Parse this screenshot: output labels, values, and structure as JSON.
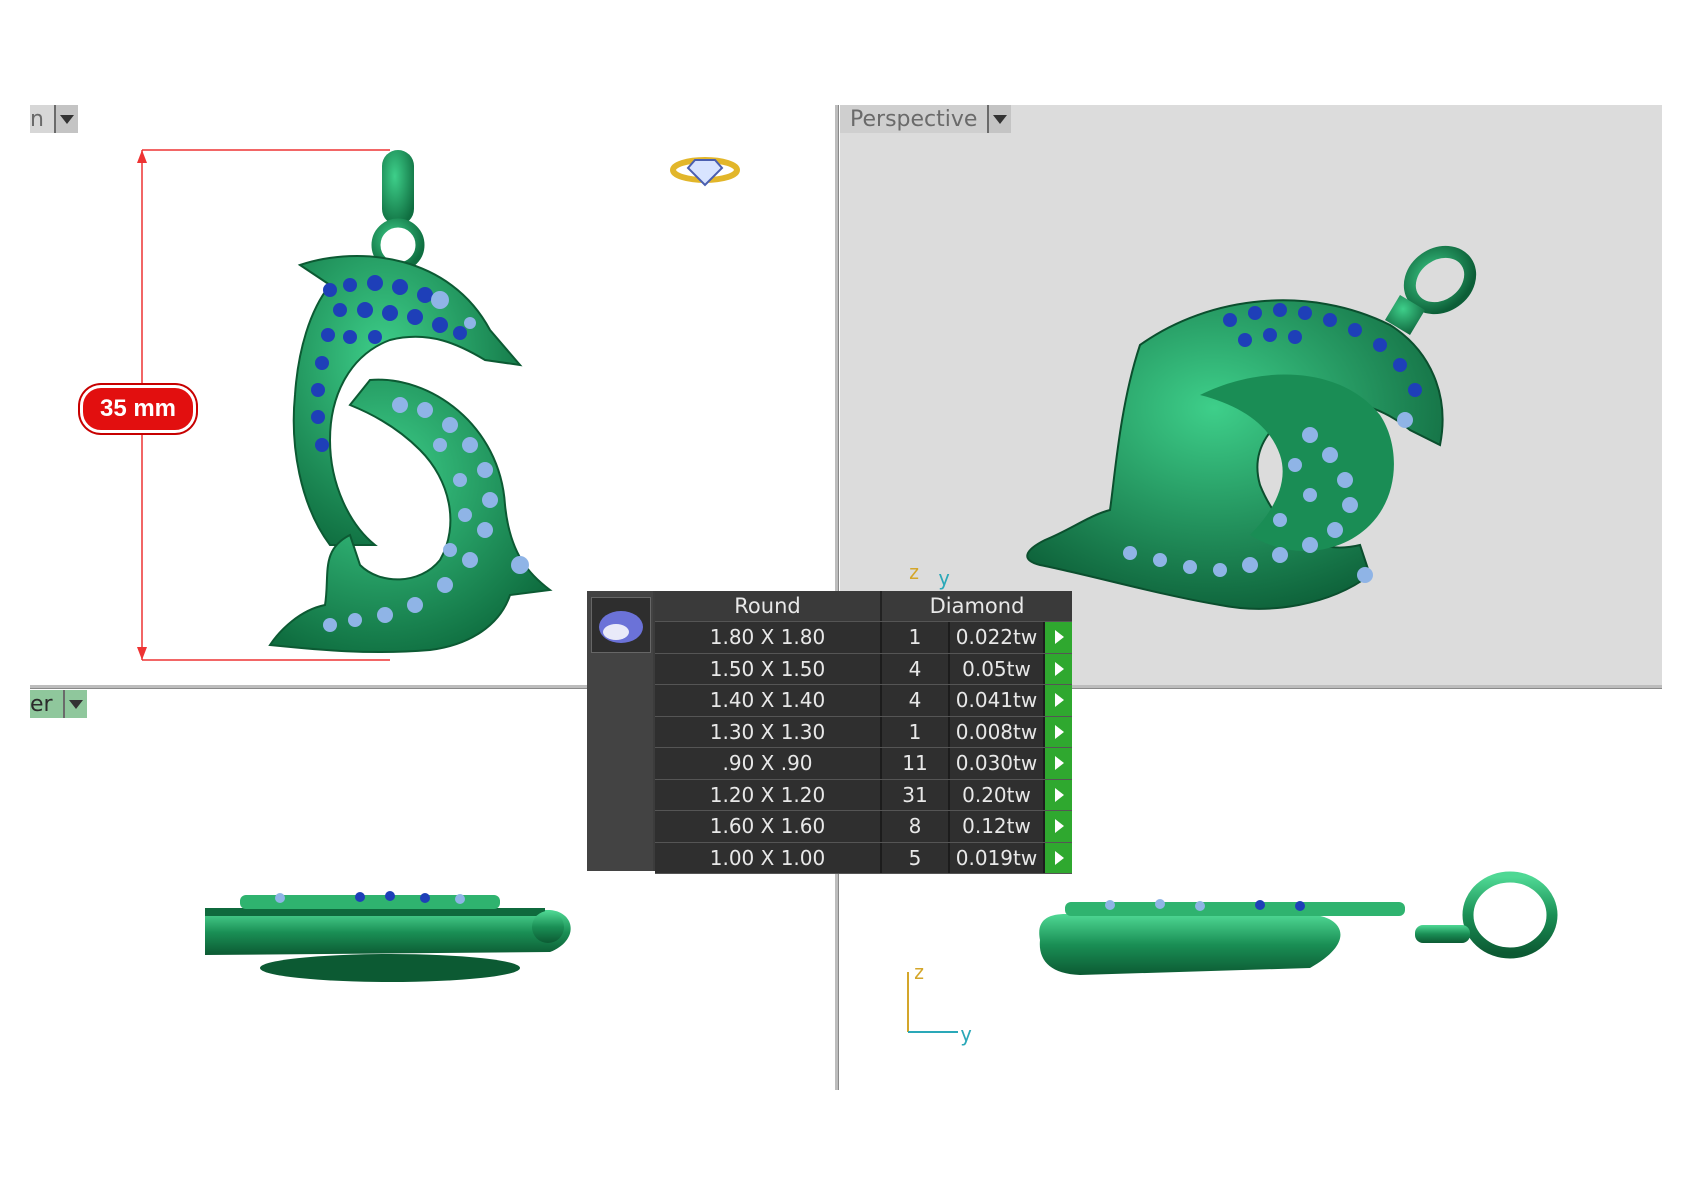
{
  "viewports": {
    "top_left": {
      "tab_label": "n"
    },
    "top_right": {
      "tab_label": "Perspective"
    },
    "bottom_left": {
      "tab_label": "er"
    }
  },
  "dimension": {
    "label": "35 mm"
  },
  "axes": {
    "z": "z",
    "y": "y"
  },
  "stone_table": {
    "shape": "Round",
    "material": "Diamond",
    "rows": [
      {
        "size": "1.80 X 1.80",
        "qty": "1",
        "weight": "0.022tw"
      },
      {
        "size": "1.50 X 1.50",
        "qty": "4",
        "weight": "0.05tw"
      },
      {
        "size": "1.40 X 1.40",
        "qty": "4",
        "weight": "0.041tw"
      },
      {
        "size": "1.30 X 1.30",
        "qty": "1",
        "weight": "0.008tw"
      },
      {
        "size": ".90 X .90",
        "qty": "11",
        "weight": "0.030tw"
      },
      {
        "size": "1.20 X 1.20",
        "qty": "31",
        "weight": "0.20tw"
      },
      {
        "size": "1.60 X 1.60",
        "qty": "8",
        "weight": "0.12tw"
      },
      {
        "size": "1.00 X 1.00",
        "qty": "5",
        "weight": "0.019tw"
      }
    ]
  },
  "colors": {
    "metal": "#1f9a5e",
    "stone_blue": "#1e3fb8",
    "stone_light": "#8fb4e6",
    "dimension_red": "#e20f0f",
    "action_green": "#2fa82f"
  }
}
